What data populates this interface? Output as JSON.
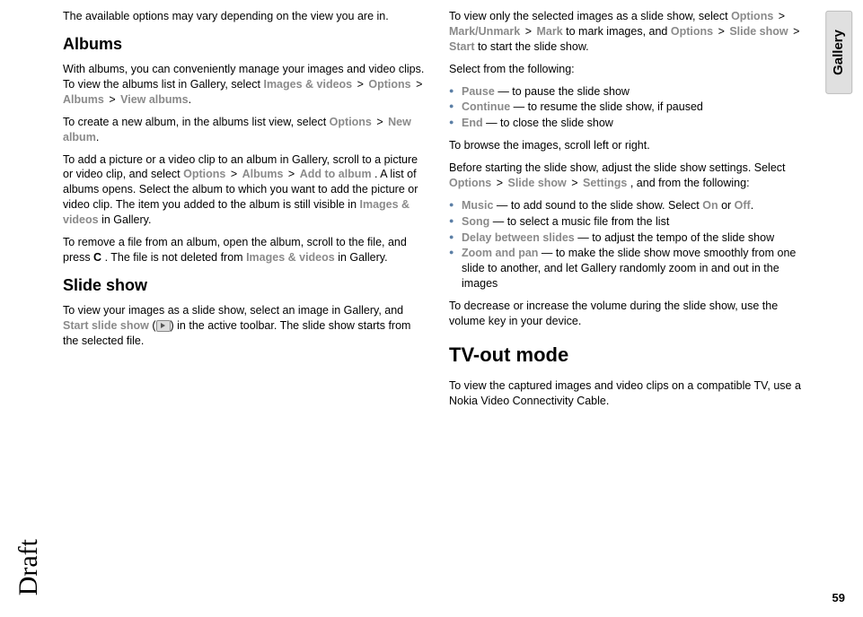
{
  "sideTab": "Gallery",
  "draftLabel": "Draft",
  "pageNumber": "59",
  "col1": {
    "introPara": "The available options may vary depending on the view you are in.",
    "albumsHeading": "Albums",
    "albums_p1_a": "With albums, you can conveniently manage your images and video clips. To view the albums list in Gallery, select ",
    "albums_p1_m1": "Images & videos",
    "albums_p1_m2": "Options",
    "albums_p1_m3": "Albums",
    "albums_p1_m4": "View albums",
    "albums_p2_a": "To create a new album, in the albums list view, select ",
    "albums_p2_m1": "Options",
    "albums_p2_m2": "New album",
    "albums_p3_a": "To add a picture or a video clip to an album in Gallery, scroll to a picture or video clip, and select ",
    "albums_p3_m1": "Options",
    "albums_p3_m2": "Albums",
    "albums_p3_m3": "Add to album",
    "albums_p3_b": ". A list of albums opens. Select the album to which you want to add the picture or video clip. The item you added to the album is still visible in ",
    "albums_p3_m4": "Images & videos",
    "albums_p3_c": " in Gallery.",
    "albums_p4_a": "To remove a file from an album, open the album, scroll to the file, and press ",
    "albums_p4_key": "C",
    "albums_p4_b": ". The file is not deleted from ",
    "albums_p4_m1": "Images & videos",
    "albums_p4_c": " in Gallery.",
    "slideHeading": "Slide show",
    "slide_p1_a": "To view your images as a slide show, select an image in Gallery, and ",
    "slide_p1_m1": "Start slide show",
    "slide_p1_b": " (",
    "slide_p1_c": ") in the active toolbar. The slide show starts from the selected file."
  },
  "col2": {
    "p1_a": "To view only the selected images as a slide show, select ",
    "p1_m1": "Options",
    "p1_m2": "Mark/Unmark",
    "p1_m3": "Mark",
    "p1_b": " to mark images, and ",
    "p1_m4": "Options",
    "p1_m5": "Slide show",
    "p1_m6": "Start",
    "p1_c": " to start the slide show.",
    "selectFrom": "Select from the following:",
    "list1": [
      {
        "term": "Pause",
        "desc": " — to pause the slide show"
      },
      {
        "term": "Continue",
        "desc": " — to resume the slide show, if paused"
      },
      {
        "term": "End",
        "desc": " — to close the slide show"
      }
    ],
    "browse": "To browse the images, scroll left or right.",
    "p2_a": "Before starting the slide show, adjust the slide show settings. Select ",
    "p2_m1": "Options",
    "p2_m2": "Slide show",
    "p2_m3": "Settings",
    "p2_b": ", and from the following:",
    "list2": [
      {
        "term": "Music",
        "desc_a": " — to add sound to the slide show. Select ",
        "opt1": "On",
        "mid": " or ",
        "opt2": "Off",
        "end": "."
      },
      {
        "term": "Song",
        "desc": " — to select a music file from the list"
      },
      {
        "term": "Delay between slides",
        "desc": " — to adjust the tempo of the slide show"
      },
      {
        "term": "Zoom and pan",
        "desc": " — to make the slide show move smoothly from one slide to another, and let Gallery randomly zoom in and out in the images"
      }
    ],
    "volume": "To decrease or increase the volume during the slide show, use the volume key in your device.",
    "tvHeading": "TV-out mode",
    "tv_p1": "To view the captured images and video clips on a compatible TV, use a Nokia Video Connectivity Cable."
  }
}
